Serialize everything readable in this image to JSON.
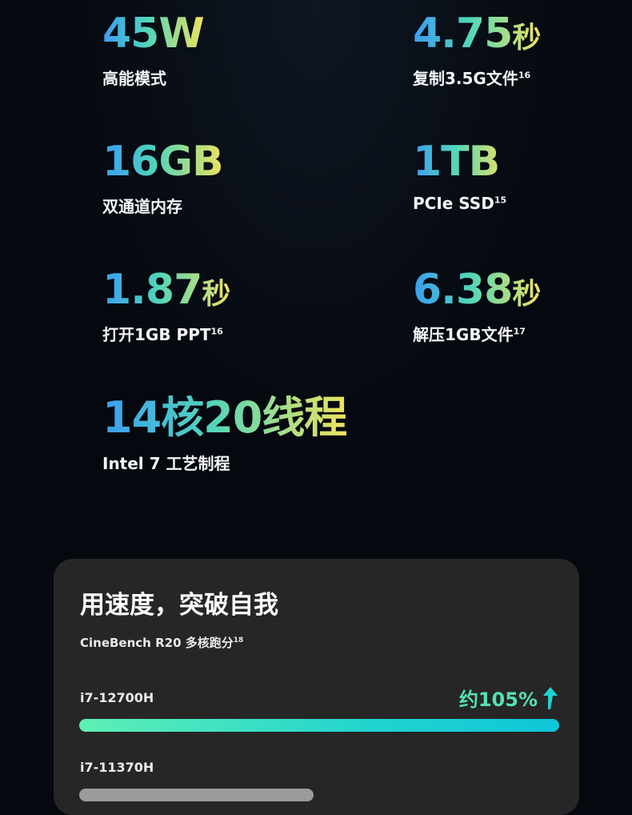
{
  "specs": [
    {
      "value": "45W",
      "unit": "",
      "label": "高能模式",
      "sup": ""
    },
    {
      "value": "4.75",
      "unit": "秒",
      "label": "复制3.5G文件",
      "sup": "16"
    },
    {
      "value": "16GB",
      "unit": "",
      "label": "双通道内存",
      "sup": ""
    },
    {
      "value": "1TB",
      "unit": "",
      "label": "PCIe SSD",
      "sup": "15"
    },
    {
      "value": "1.87",
      "unit": "秒",
      "label": "打开1GB PPT",
      "sup": "16"
    },
    {
      "value": "6.38",
      "unit": "秒",
      "label": "解压1GB文件",
      "sup": "17"
    },
    {
      "value": "14核20线程",
      "unit": "",
      "label": "Intel 7 工艺制程",
      "sup": ""
    }
  ],
  "card": {
    "title": "用速度，突破自我",
    "subtitle": "CineBench R20 多核跑分",
    "subtitle_sup": "18",
    "bench_new": {
      "name": "i7-12700H",
      "gain": "约105%"
    },
    "bench_old": {
      "name": "i7-11370H"
    }
  },
  "colors": {
    "background": "#05080e",
    "card": "#262626",
    "accent_blue": "#3b9df2",
    "accent_green": "#52d6b9",
    "accent_yellow": "#f0e35e",
    "bar_new": "#22d4cf",
    "bar_old": "#9b9b9b"
  },
  "icons": {
    "gain_arrow": "arrow-up-icon"
  }
}
